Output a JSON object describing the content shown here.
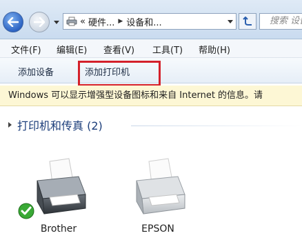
{
  "address_bar": {
    "crumb_overflow": "«",
    "crumb_1": "硬件...",
    "crumb_2": "设备和...",
    "search_placeholder": "搜索 设备"
  },
  "menu": {
    "file": "文件(F)",
    "edit": "编辑(E)",
    "view": "查看(V)",
    "tools": "工具(T)",
    "help": "帮助(H)"
  },
  "toolbar": {
    "add_device": "添加设备",
    "add_printer": "添加打印机"
  },
  "infobar": {
    "text": "Windows 可以显示增强型设备图标和来自 Internet 的信息。请"
  },
  "group": {
    "title": "打印机和传真 (2)"
  },
  "devices": [
    {
      "name": "Brother",
      "default": true,
      "icon": "printer-icon"
    },
    {
      "name": "EPSON",
      "default": false,
      "icon": "printer-icon"
    }
  ],
  "colors": {
    "highlight": "#d4202a",
    "infobar_bg": "#fdf7d5",
    "group_title": "#1b3d7a",
    "default_check": "#39a935"
  }
}
